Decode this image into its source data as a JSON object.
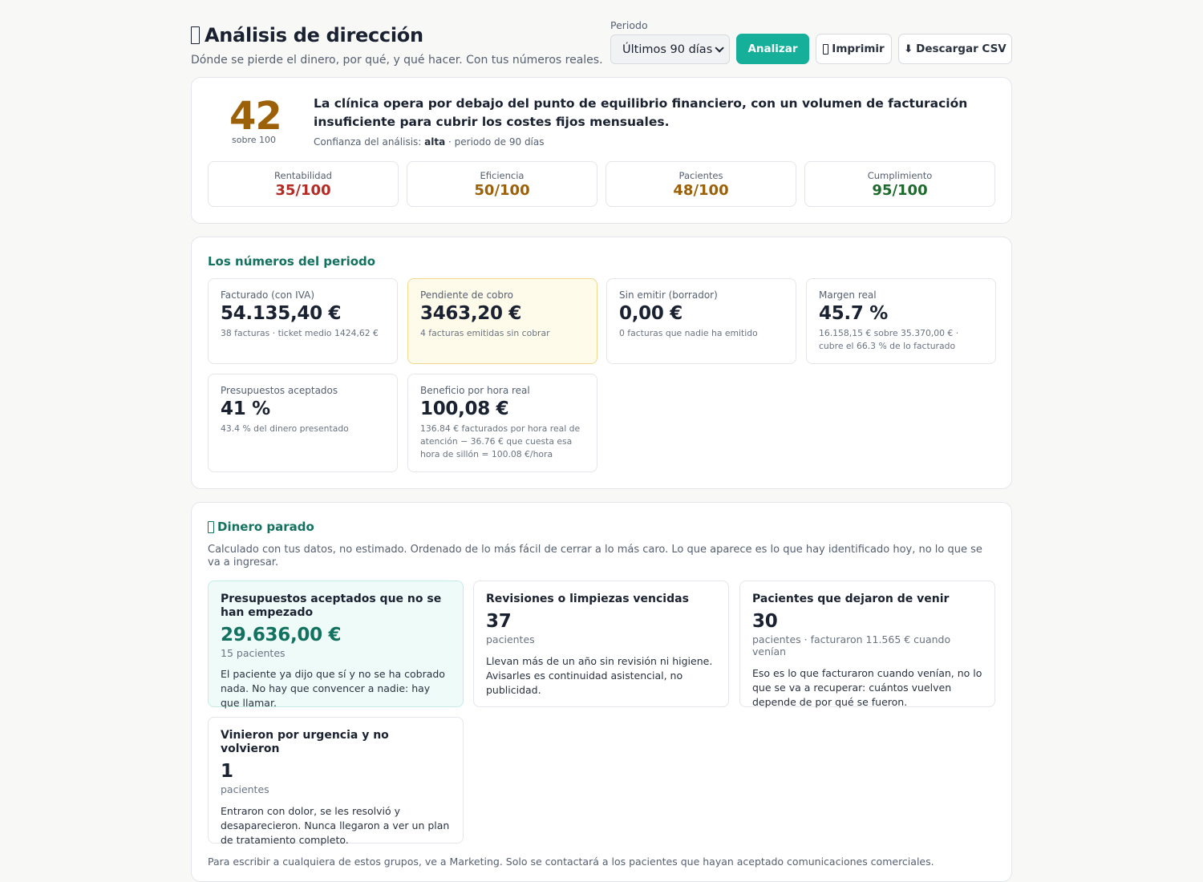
{
  "header": {
    "title": "Análisis de dirección",
    "subtitle": "Dónde se pierde el dinero, por qué, y qué hacer. Con tus números reales.",
    "period_label": "Periodo",
    "period_selected": "Últimos 90 días",
    "analyze_label": "Analizar",
    "print_label": "Imprimir",
    "csv_label": "Descargar CSV"
  },
  "score": {
    "value": "42",
    "of": "sobre 100",
    "verdict": "La clínica opera por debajo del punto de equilibrio financiero, con un volumen de facturación insuficiente para cubrir los costes fijos mensuales.",
    "confidence_prefix": "Confianza del análisis:",
    "confidence_level": "alta",
    "confidence_suffix": "· periodo de 90 días",
    "metrics": [
      {
        "label": "Rentabilidad",
        "value": "35/100",
        "color": "#b52a22"
      },
      {
        "label": "Eficiencia",
        "value": "50/100",
        "color": "#9c6108"
      },
      {
        "label": "Pacientes",
        "value": "48/100",
        "color": "#9c6108"
      },
      {
        "label": "Cumplimiento",
        "value": "95/100",
        "color": "#1d6b2c"
      }
    ]
  },
  "numbers": {
    "title": "Los números del periodo",
    "kpis": [
      {
        "label": "Facturado (con IVA)",
        "value": "54.135,40 €",
        "note": "38 facturas · ticket medio 1424,62 €"
      },
      {
        "label": "Pendiente de cobro",
        "value": "3463,20 €",
        "note": "4 facturas emitidas sin cobrar"
      },
      {
        "label": "Sin emitir (borrador)",
        "value": "0,00 €",
        "note": "0 facturas que nadie ha emitido"
      },
      {
        "label": "Margen real",
        "value": "45.7 %",
        "note": "16.158,15 € sobre 35.370,00 € · cubre el 66.3 % de lo facturado"
      },
      {
        "label": "Presupuestos aceptados",
        "value": "41 %",
        "note": "43.4 % del dinero presentado"
      },
      {
        "label": "Beneficio por hora real",
        "value": "100,08 €",
        "note": "136.84 € facturados por hora real de atención − 36.76 € que cuesta esa hora de sillón = 100.08 €/hora"
      }
    ]
  },
  "idle_money": {
    "title": "Dinero parado",
    "intro": "Calculado con tus datos, no estimado. Ordenado de lo más fácil de cerrar a lo más caro. Lo que aparece es lo que hay identificado hoy, no lo que se va a ingresar.",
    "items": [
      {
        "title": "Presupuestos aceptados que no se han empezado",
        "value": "29.636,00 €",
        "unit": "15 pacientes",
        "desc": "El paciente ya dijo que sí y no se ha cobrado nada. No hay que convencer a nadie: hay que llamar."
      },
      {
        "title": "Revisiones o limpiezas vencidas",
        "value": "37",
        "unit": "pacientes",
        "desc": "Llevan más de un año sin revisión ni higiene. Avisarles es continuidad asistencial, no publicidad."
      },
      {
        "title": "Pacientes que dejaron de venir",
        "value": "30",
        "unit": "pacientes · facturaron 11.565 € cuando venían",
        "desc": "Eso es lo que facturaron cuando venían, no lo que se va a recuperar: cuántos vuelven depende de por qué se fueron."
      },
      {
        "title": "Vinieron por urgencia y no volvieron",
        "value": "1",
        "unit": "pacientes",
        "desc": "Entraron con dolor, se les resolvió y desaparecieron. Nunca llegaron a ver un plan de tratamiento completo."
      }
    ],
    "footnote": "Para escribir a cualquiera de estos grupos, ve a Marketing. Solo se contactará a los pacientes que hayan aceptado comunicaciones comerciales."
  }
}
